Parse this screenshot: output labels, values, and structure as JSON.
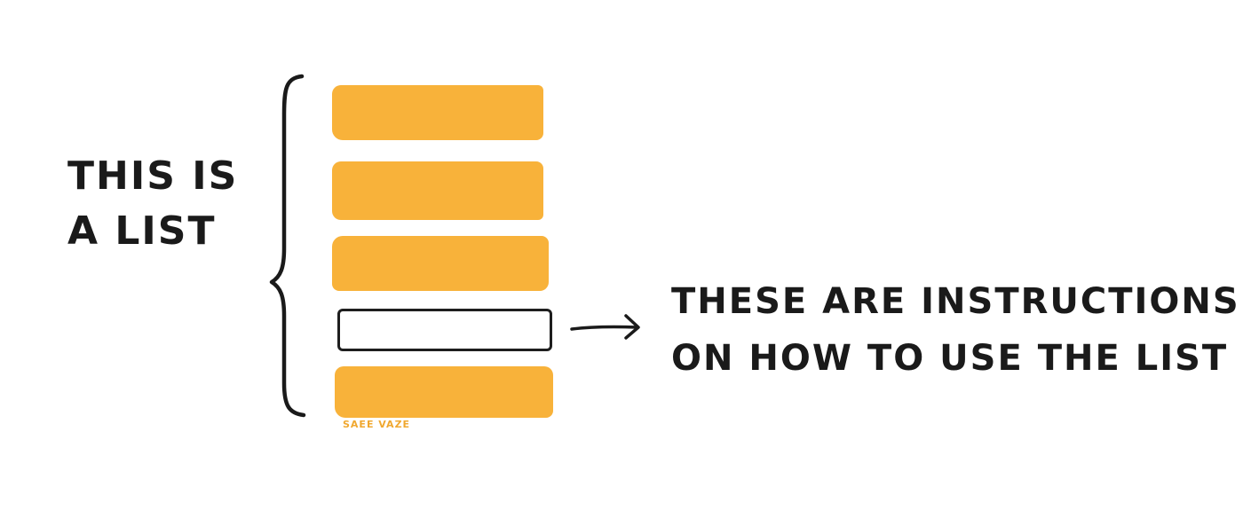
{
  "diagram": {
    "left_label": {
      "lines": [
        "THIS IS",
        "A LIST"
      ]
    },
    "right_label": {
      "lines": [
        "THESE ARE INSTRUCTIONS",
        "ON HOW TO USE THE LIST"
      ]
    },
    "signature": "SAEE VAZE",
    "list_items": [
      {
        "style": "filled"
      },
      {
        "style": "filled"
      },
      {
        "style": "filled"
      },
      {
        "style": "outline"
      },
      {
        "style": "filled"
      }
    ],
    "colors": {
      "bar_fill": "#f8b23a",
      "ink": "#1a1a1a",
      "signature": "#f0a830"
    },
    "icons": {
      "brace": "curly-brace-icon",
      "arrow": "right-arrow-icon"
    }
  }
}
